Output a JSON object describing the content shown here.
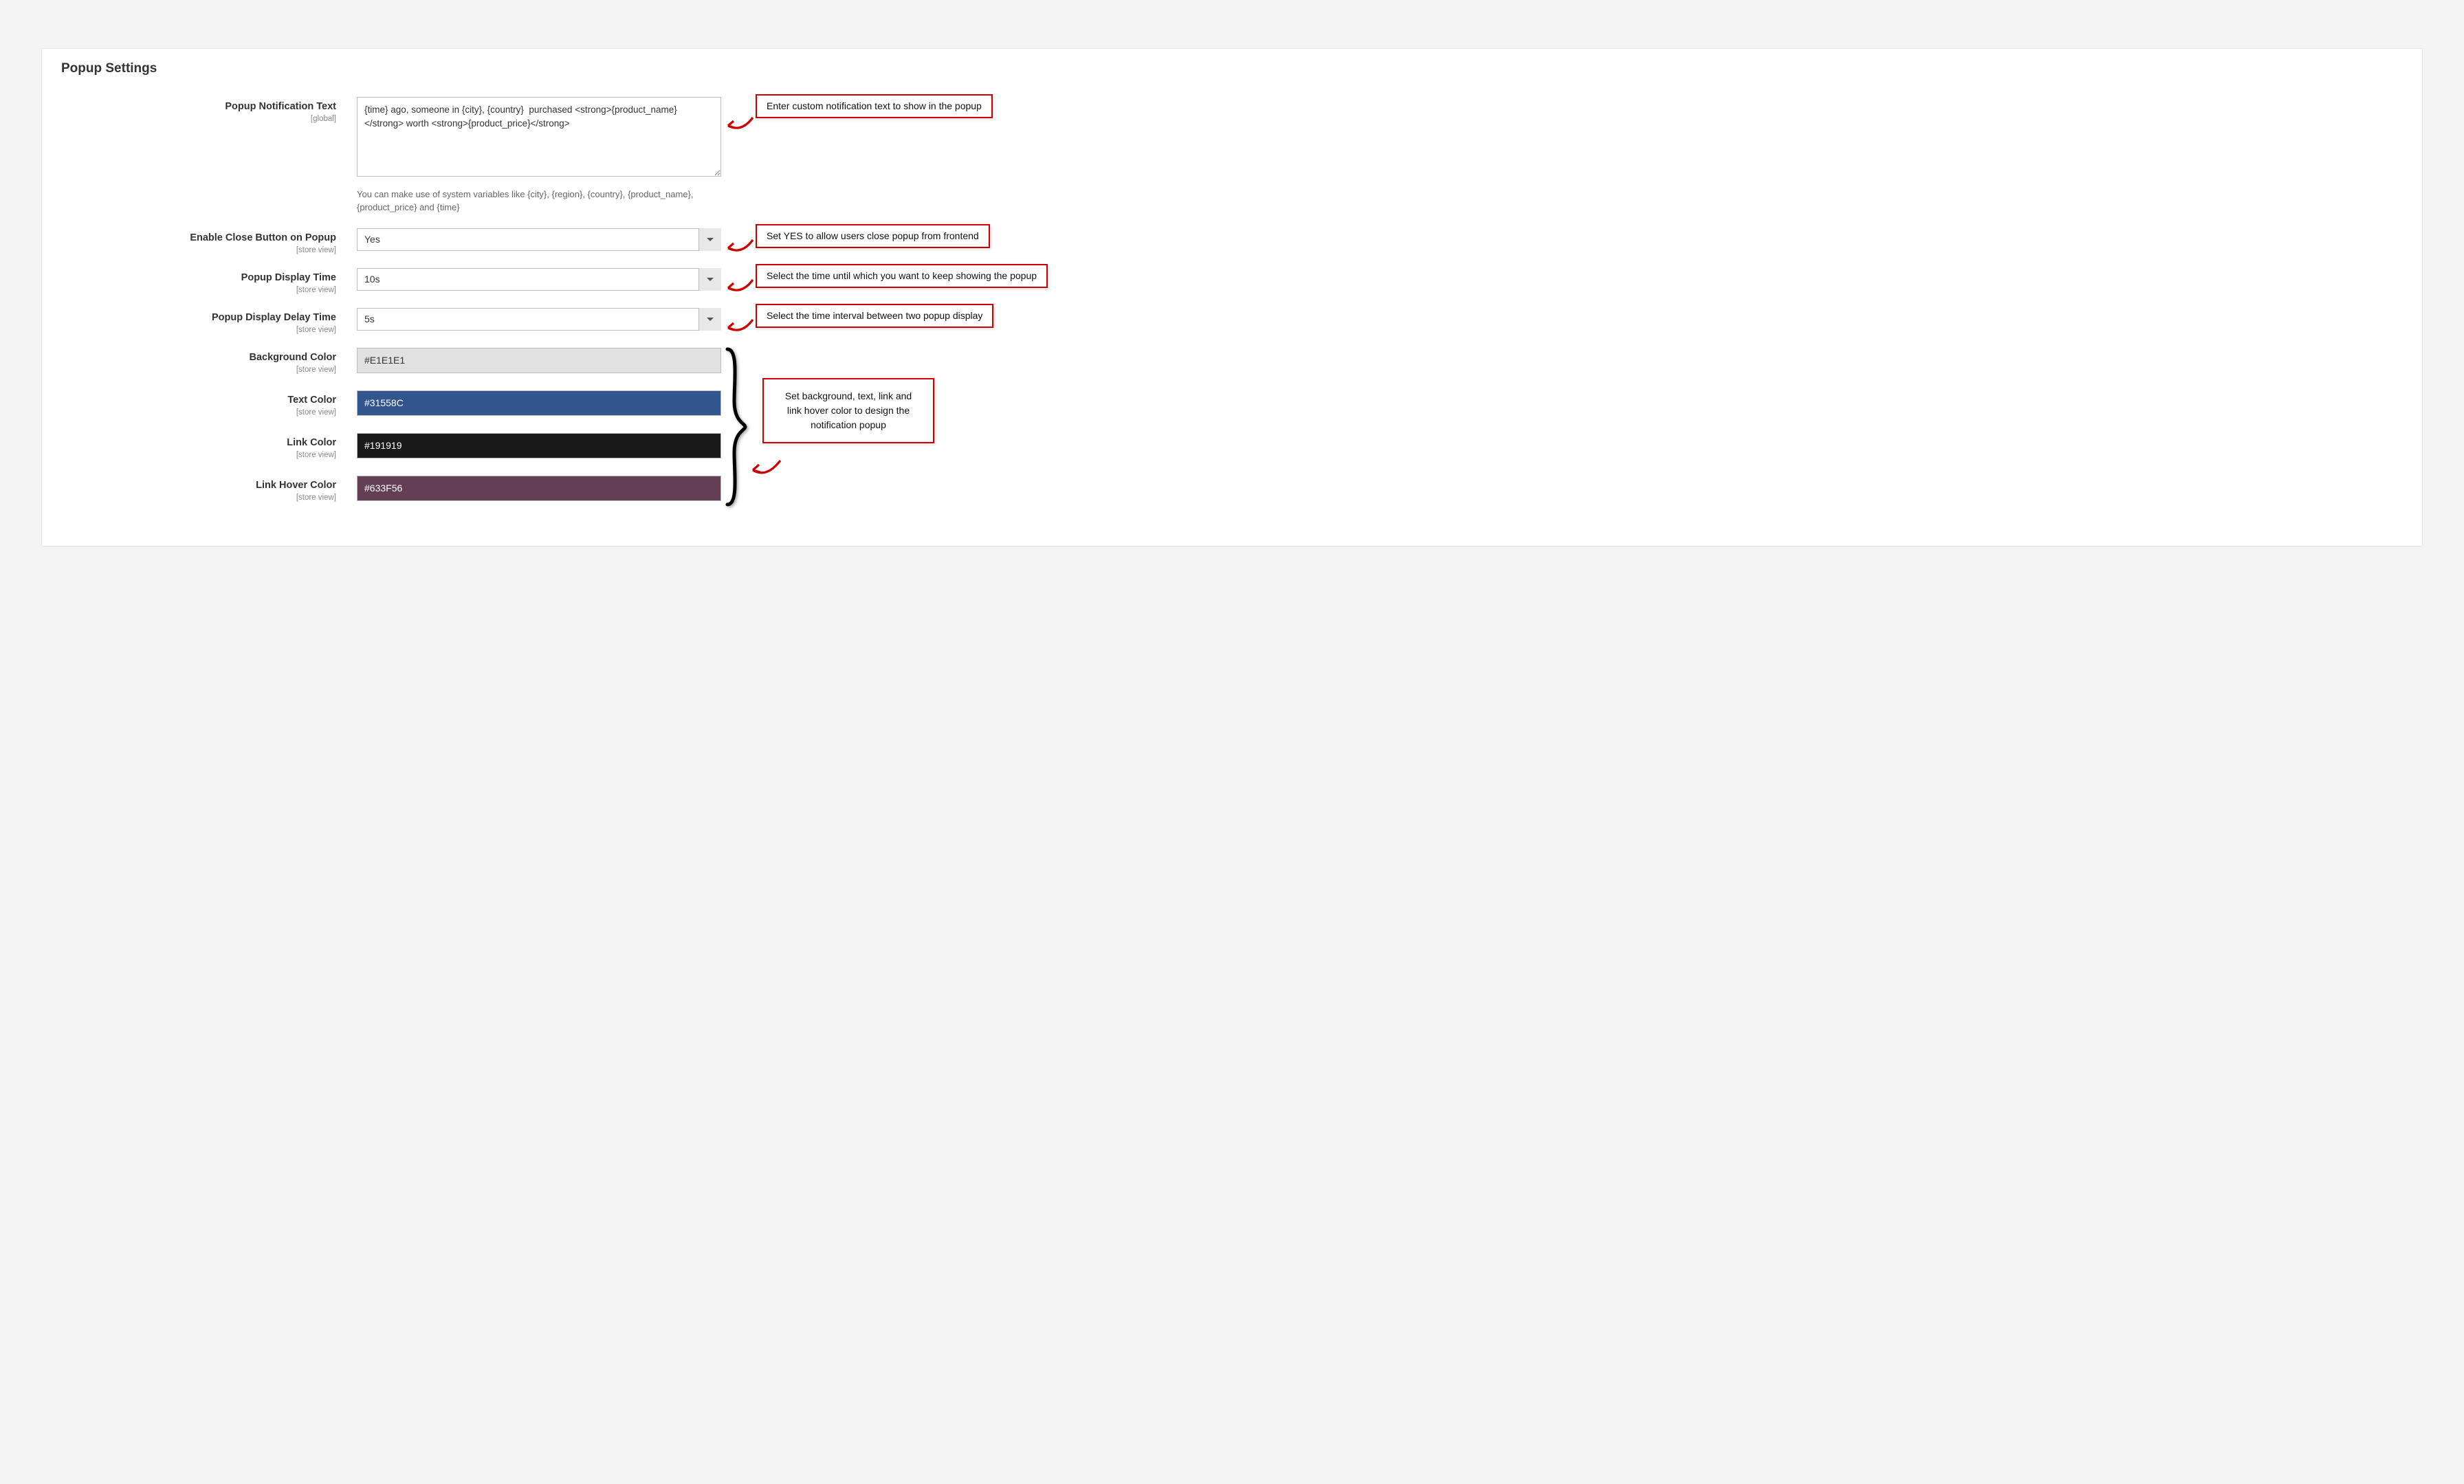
{
  "panel": {
    "title": "Popup Settings"
  },
  "fields": {
    "notificationText": {
      "label": "Popup Notification Text",
      "scope": "[global]",
      "value": "{time} ago, someone in {city}, {country}  purchased <strong>{product_name}</strong> worth <strong>{product_price}</strong>",
      "help": "You can make use of system variables like {city}, {region}, {country}, {product_name}, {product_price} and {time}"
    },
    "enableClose": {
      "label": "Enable Close Button on Popup",
      "scope": "[store view]",
      "value": "Yes"
    },
    "displayTime": {
      "label": "Popup Display Time",
      "scope": "[store view]",
      "value": "10s"
    },
    "displayDelayTime": {
      "label": "Popup Display Delay Time",
      "scope": "[store view]",
      "value": "5s"
    },
    "backgroundColor": {
      "label": "Background Color",
      "scope": "[store view]",
      "value": "#E1E1E1"
    },
    "textColor": {
      "label": "Text Color",
      "scope": "[store view]",
      "value": "#31558C"
    },
    "linkColor": {
      "label": "Link Color",
      "scope": "[store view]",
      "value": "#191919"
    },
    "linkHoverColor": {
      "label": "Link Hover Color",
      "scope": "[store view]",
      "value": "#633F56"
    }
  },
  "callouts": {
    "notificationText": "Enter custom notification text to show in the popup",
    "enableClose": "Set YES to allow users close popup from frontend",
    "displayTime": "Select the time until which you want to keep showing the popup",
    "displayDelayTime": "Select the time interval between two popup display",
    "colors": "Set background, text, link and link hover color to design the notification popup"
  }
}
